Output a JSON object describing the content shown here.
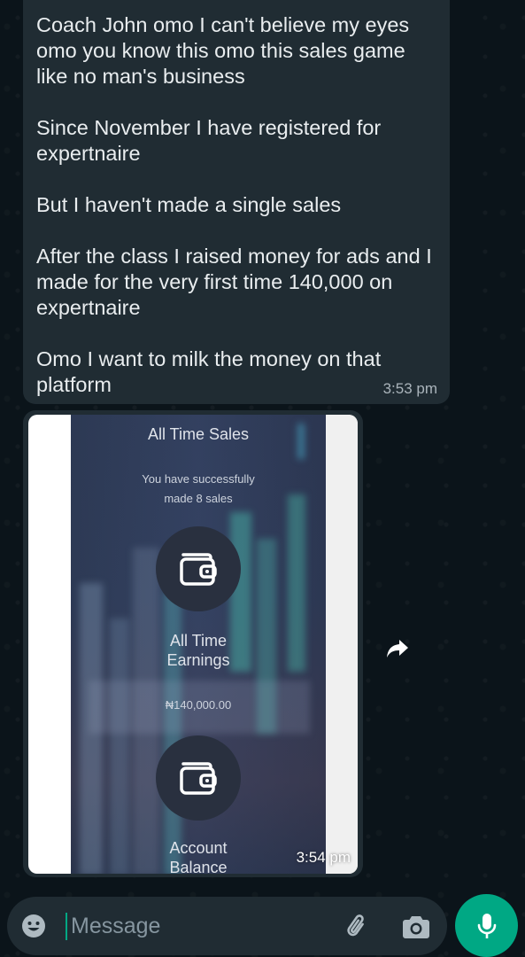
{
  "message": {
    "paragraphs": [
      "Coach John omo I can't believe my eyes omo you know this omo this sales game like no man's business",
      "Since November I have registered for expertnaire",
      "But I haven't made a single sales",
      "After the class I raised money for ads and I made for the very first time 140,000 on expertnaire",
      "Omo I want to milk the money on that platform"
    ],
    "time": "3:53 pm"
  },
  "image_message": {
    "title": "All Time Sales",
    "subtitle_line1": "You have successfully",
    "subtitle_line2": "made 8 sales",
    "earnings_label_line1": "All Time",
    "earnings_label_line2": "Earnings",
    "earnings_amount": "₦140,000.00",
    "balance_label_line1": "Account",
    "balance_label_line2": "Balance",
    "time": "3:54 pm"
  },
  "composer": {
    "placeholder": "Message"
  },
  "icons": {
    "emoji": "emoji-icon",
    "attach": "paperclip-icon",
    "camera": "camera-icon",
    "mic": "microphone-icon",
    "forward": "forward-icon",
    "wallet": "wallet-icon"
  },
  "colors": {
    "background": "#0b141a",
    "bubble": "#202c33",
    "accent": "#00a884",
    "text": "#e9edef",
    "meta": "#8696a0"
  }
}
